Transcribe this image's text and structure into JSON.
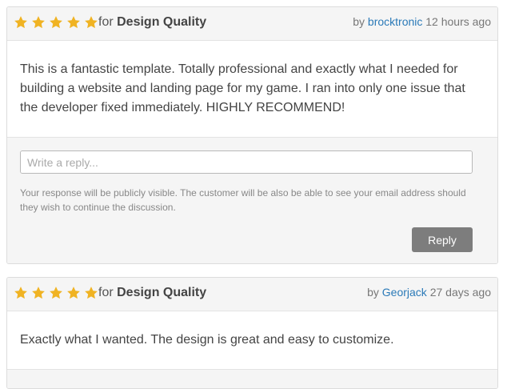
{
  "colors": {
    "star": "#f0b323",
    "link": "#2b7ab8",
    "button": "#7d7d7d"
  },
  "reviews": [
    {
      "stars": 5,
      "for_prefix": "for",
      "category": "Design Quality",
      "by_prefix": "by",
      "author": "brocktronic",
      "time": "12 hours ago",
      "text": "This is a fantastic template. Totally professional and exactly what I needed for building a website and landing page for my game. I ran into only one issue that the developer fixed immediately. HIGHLY RECOMMEND!",
      "reply": {
        "placeholder": "Write a reply...",
        "notice": "Your response will be publicly visible. The customer will be also be able to see your email address should they wish to continue the discussion.",
        "button_label": "Reply"
      }
    },
    {
      "stars": 5,
      "for_prefix": "for",
      "category": "Design Quality",
      "by_prefix": "by",
      "author": "Georjack",
      "time": "27 days ago",
      "text": "Exactly what I wanted. The design is great and easy to customize."
    }
  ]
}
